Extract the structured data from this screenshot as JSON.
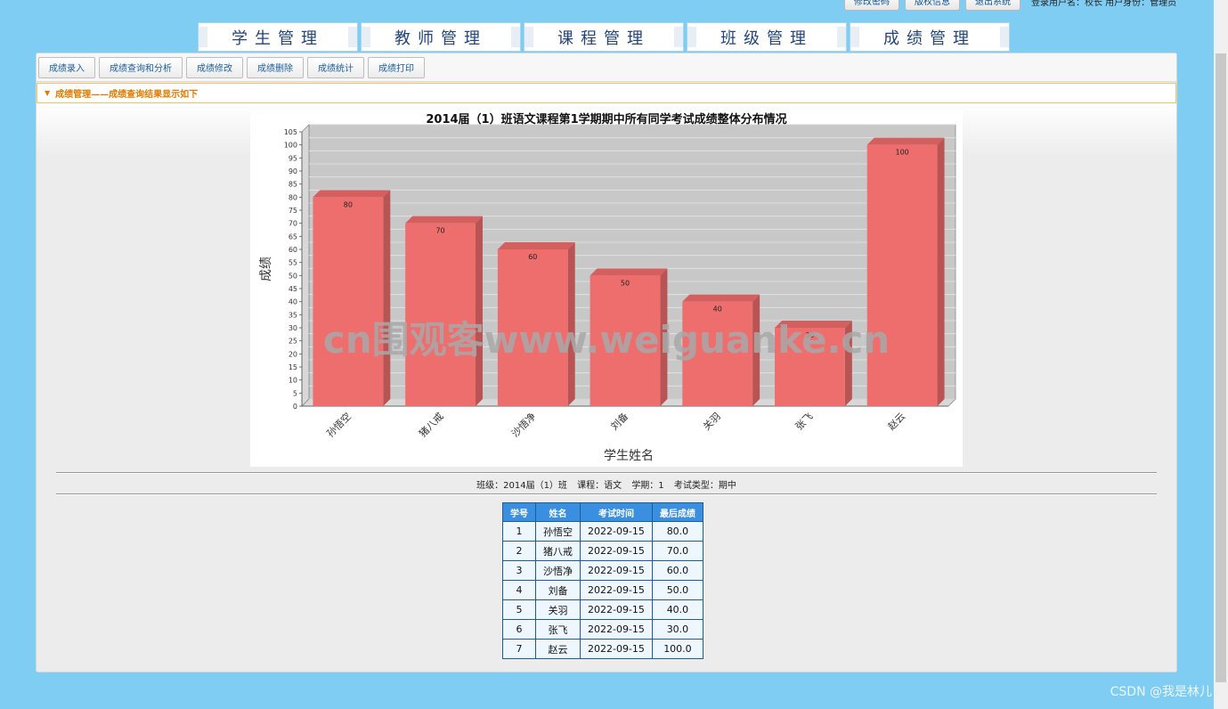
{
  "topbar": {
    "buttons": [
      "修改密码",
      "版权信息",
      "退出系统"
    ],
    "user_info": "登录用户名：校长 用户身份：管理员"
  },
  "main_tabs": [
    "学生管理",
    "教师管理",
    "课程管理",
    "班级管理",
    "成绩管理"
  ],
  "sub_toolbar": [
    "成绩录入",
    "成绩查询和分析",
    "成绩修改",
    "成绩删除",
    "成绩统计",
    "成绩打印"
  ],
  "breadcrumb": "成绩管理——成绩查询结果显示如下",
  "chart_data": {
    "type": "bar",
    "title": "2014届（1）班语文课程第1学期期中所有同学考试成绩整体分布情况",
    "xlabel": "学生姓名",
    "ylabel": "成绩",
    "categories": [
      "孙悟空",
      "猪八戒",
      "沙悟净",
      "刘备",
      "关羽",
      "张飞",
      "赵云"
    ],
    "values": [
      80,
      70,
      60,
      50,
      40,
      30,
      100
    ],
    "data_labels": [
      "80",
      "70",
      "60",
      "50",
      "40",
      "30",
      "100"
    ],
    "ylim": [
      0,
      105
    ],
    "y_ticks": [
      0,
      5,
      10,
      15,
      20,
      25,
      30,
      35,
      40,
      45,
      50,
      55,
      60,
      65,
      70,
      75,
      80,
      85,
      90,
      95,
      100,
      105
    ],
    "bar_color": "#ee6e6e",
    "plot_bg": "#c8c8c8",
    "grid": true,
    "watermark": "cn围观客www.weiguanke.cn"
  },
  "info": {
    "class": "班级：2014届（1）班",
    "course": "课程：语文",
    "term": "学期：1",
    "exam_type": "考试类型：期中"
  },
  "table": {
    "headers": [
      "学号",
      "姓名",
      "考试时间",
      "最后成绩"
    ],
    "rows": [
      [
        "1",
        "孙悟空",
        "2022-09-15",
        "80.0"
      ],
      [
        "2",
        "猪八戒",
        "2022-09-15",
        "70.0"
      ],
      [
        "3",
        "沙悟净",
        "2022-09-15",
        "60.0"
      ],
      [
        "4",
        "刘备",
        "2022-09-15",
        "50.0"
      ],
      [
        "5",
        "关羽",
        "2022-09-15",
        "40.0"
      ],
      [
        "6",
        "张飞",
        "2022-09-15",
        "30.0"
      ],
      [
        "7",
        "赵云",
        "2022-09-15",
        "100.0"
      ]
    ]
  },
  "credit": "CSDN @我是林儿"
}
